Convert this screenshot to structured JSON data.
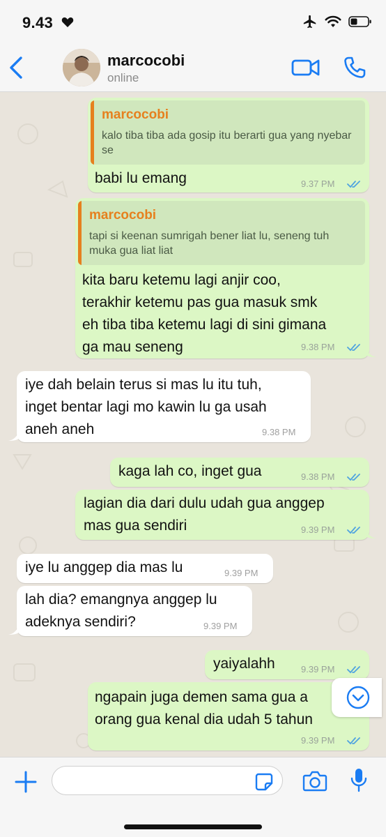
{
  "status_bar": {
    "time": "9.43",
    "icons": [
      "heart-icon",
      "airplane-icon",
      "wifi-icon",
      "battery-icon"
    ]
  },
  "header": {
    "back_icon": "chevron-left-icon",
    "contact_name": "marcocobi",
    "contact_status": "online",
    "video_icon": "video-camera-icon",
    "call_icon": "phone-icon"
  },
  "colors": {
    "accent": "#1a7cf3",
    "outgoing_bubble": "#dcf7c5",
    "incoming_bubble": "#ffffff",
    "quote_name": "#e6801e",
    "read_ticks": "#4fa3e0"
  },
  "messages": [
    {
      "direction": "outgoing",
      "quote": {
        "author": "marcocobi",
        "text": "kalo tiba tiba ada gosip itu berarti gua yang nyebar se"
      },
      "text": "babi lu emang",
      "time": "9.37 PM",
      "read": true
    },
    {
      "direction": "outgoing",
      "quote": {
        "author": "marcocobi",
        "text": "tapi si keenan sumrigah bener liat lu, seneng tuh muka gua liat liat"
      },
      "text": "kita baru ketemu lagi anjir coo,\nterakhir ketemu pas gua masuk smk\neh tiba tiba ketemu lagi di sini gimana\nga mau seneng",
      "time": "9.38 PM",
      "read": true
    },
    {
      "direction": "incoming",
      "text": "iye dah belain terus si mas lu itu tuh,\ninget bentar lagi mo kawin lu ga usah\naneh aneh",
      "time": "9.38 PM"
    },
    {
      "direction": "outgoing",
      "text": "kaga lah co, inget gua",
      "time": "9.38 PM",
      "read": true
    },
    {
      "direction": "outgoing",
      "text": "lagian dia dari dulu udah gua anggep\nmas gua sendiri",
      "time": "9.39 PM",
      "read": true
    },
    {
      "direction": "incoming",
      "text": "iye lu anggep dia mas lu",
      "time": "9.39 PM"
    },
    {
      "direction": "incoming",
      "text": "lah dia? emangnya anggep lu\nadeknya sendiri?",
      "time": "9.39 PM"
    },
    {
      "direction": "outgoing",
      "text": "yaiyalahh",
      "time": "9.39 PM",
      "read": true
    },
    {
      "direction": "outgoing",
      "text": "ngapain juga demen sama gua a\norang gua kenal dia udah 5 tahun",
      "time": "9.39 PM",
      "read": true
    }
  ],
  "scroll_down_icon": "chevron-down-circle-icon",
  "input_bar": {
    "plus_icon": "plus-icon",
    "placeholder": "",
    "sticker_icon": "sticker-icon",
    "camera_icon": "camera-icon",
    "mic_icon": "microphone-icon"
  }
}
